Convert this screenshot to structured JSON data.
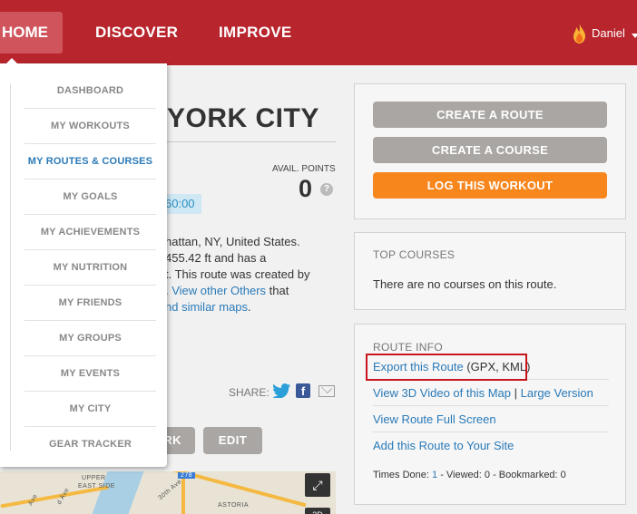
{
  "nav": {
    "home": "HOME",
    "discover": "DISCOVER",
    "improve": "IMPROVE",
    "user": "Daniel"
  },
  "main": {
    "title": "YORK CITY",
    "points_label": "AVAIL. POINTS",
    "points_value": "0",
    "time_badge": "60:00",
    "desc": [
      "hattan, NY, United States.",
      "455.42 ft and has a",
      "t. This route was created by",
      ". ",
      "View other Others",
      " that",
      "nd similar maps",
      "."
    ],
    "share_label": "SHARE:",
    "work_button": "RK",
    "edit_button": "EDIT",
    "map_labels": [
      "UPPER",
      "EAST SIDE",
      "278",
      "30th Ave",
      "ASTORIA",
      "d Ave",
      "Ave",
      "2D"
    ]
  },
  "menu": {
    "items": [
      {
        "label": "DASHBOARD",
        "active": false
      },
      {
        "label": "MY WORKOUTS",
        "active": false
      },
      {
        "label": "MY ROUTES & COURSES",
        "active": true
      },
      {
        "label": "MY GOALS",
        "active": false
      },
      {
        "label": "MY ACHIEVEMENTS",
        "active": false
      },
      {
        "label": "MY NUTRITION",
        "active": false
      },
      {
        "label": "MY FRIENDS",
        "active": false
      },
      {
        "label": "MY GROUPS",
        "active": false
      },
      {
        "label": "MY EVENTS",
        "active": false
      },
      {
        "label": "MY CITY",
        "active": false
      },
      {
        "label": "GEAR TRACKER",
        "active": false
      }
    ]
  },
  "sidebar": {
    "create_route": "CREATE A ROUTE",
    "create_course": "CREATE A COURSE",
    "log_workout": "LOG THIS WORKOUT",
    "top_courses_heading": "TOP COURSES",
    "no_courses": "There are no courses on this route.",
    "route_info_heading": "ROUTE INFO",
    "export_link": "Export this Route",
    "export_formats": "(GPX, KML)",
    "video_link": "View 3D Video of this Map",
    "separator": "|",
    "large_version_link": "Large Version",
    "fullscreen_link": "View Route Full Screen",
    "add_site_link": "Add this Route to Your Site",
    "times_done_label": "Times Done: ",
    "times_done_value": "1",
    "viewed": " - Viewed: 0 - Bookmarked: 0"
  },
  "colors": {
    "nav_bg": "#b8252d",
    "accent_orange": "#f7861d",
    "link_blue": "#2a7ab8",
    "highlight_red": "#c8161d"
  }
}
